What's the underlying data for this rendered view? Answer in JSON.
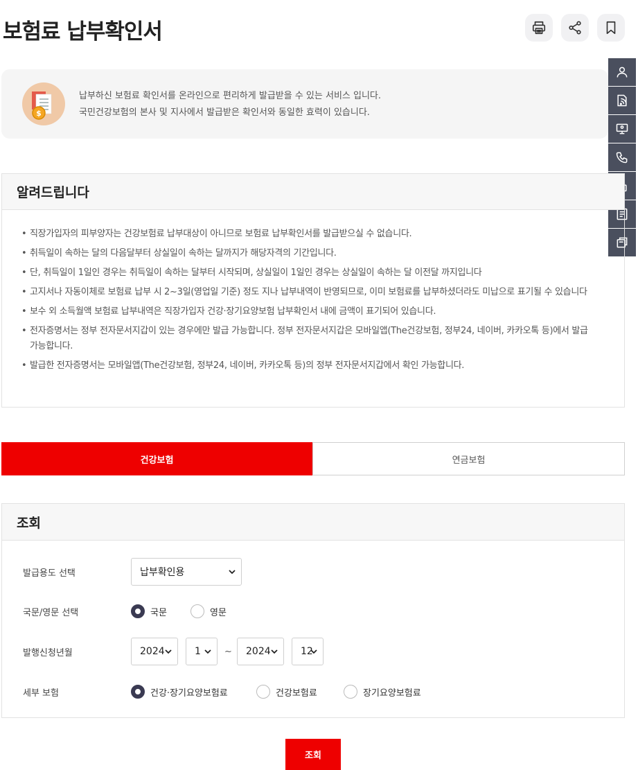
{
  "page": {
    "title": "보험료 납부확인서"
  },
  "actions": {
    "print": "print-icon",
    "share": "share-icon",
    "bookmark": "bookmark-icon"
  },
  "intro": {
    "line1": "납부하신 보험료 확인서를 온라인으로 편리하게 발급받을 수 있는 서비스 입니다.",
    "line2": "국민건강보험의 본사 및 지사에서 발급받은 확인서와 동일한 효력이 있습니다."
  },
  "notice": {
    "title": "알려드립니다",
    "items": [
      "직장가입자의 피부양자는 건강보험료 납부대상이 아니므로 보험료 납부확인서를 발급받으실 수 없습니다.",
      "취득일이 속하는 달의 다음달부터 상실일이 속하는 달까지가 해당자격의 기간입니다.",
      "단, 취득일이 1일인 경우는 취득일이 속하는 달부터 시작되며, 상실일이 1일인 경우는 상실일이 속하는 달 이전달 까지입니다",
      "고지서나 자동이체로 보험료 납부 시 2~3일(영업일 기준) 정도 지나 납부내역이 반영되므로, 이미 보험료를 납부하셨더라도 미납으로 표기될 수 있습니다",
      "보수 외 소득월액 보험료 납부내역은 직장가입자 건강·장기요양보험 납부확인서 내에 금액이 표기되어 있습니다.",
      "전자증명서는 정부 전자문서지갑이 있는 경우에만 발급 가능합니다. 정부 전자문서지갑은 모바일앱(The건강보험, 정부24, 네이버, 카카오톡 등)에서 발급 가능합니다.",
      "발급한 전자증명서는 모바일앱(The건강보험, 정부24, 네이버, 카카오톡 등)의 정부 전자문서지갑에서 확인 가능합니다."
    ]
  },
  "tabs": [
    {
      "label": "건강보험",
      "active": true
    },
    {
      "label": "연금보험",
      "active": false
    }
  ],
  "search": {
    "title": "조회",
    "purpose": {
      "label": "발급용도 선택",
      "value": "납부확인용"
    },
    "language": {
      "label": "국문/영문 선택",
      "options": [
        "국문",
        "영문"
      ],
      "selected": "국문"
    },
    "period": {
      "label": "발행신청년월",
      "from_year": "2024",
      "from_month": "1",
      "separator": "~",
      "to_year": "2024",
      "to_month": "12"
    },
    "detail": {
      "label": "세부 보험",
      "options": [
        "건강·장기요양보험료",
        "건강보험료",
        "장기요양보험료"
      ],
      "selected": "건강·장기요양보험료"
    },
    "submit_label": "조회"
  },
  "side_menu": [
    "person-icon",
    "document-signal-icon",
    "monitor-icon",
    "phone-icon",
    "lock-icon",
    "list-icon",
    "window-icon"
  ],
  "colors": {
    "accent": "#ee0000",
    "side_menu_bg": "#4a4f5e",
    "radio_checked": "#3a3a52"
  }
}
